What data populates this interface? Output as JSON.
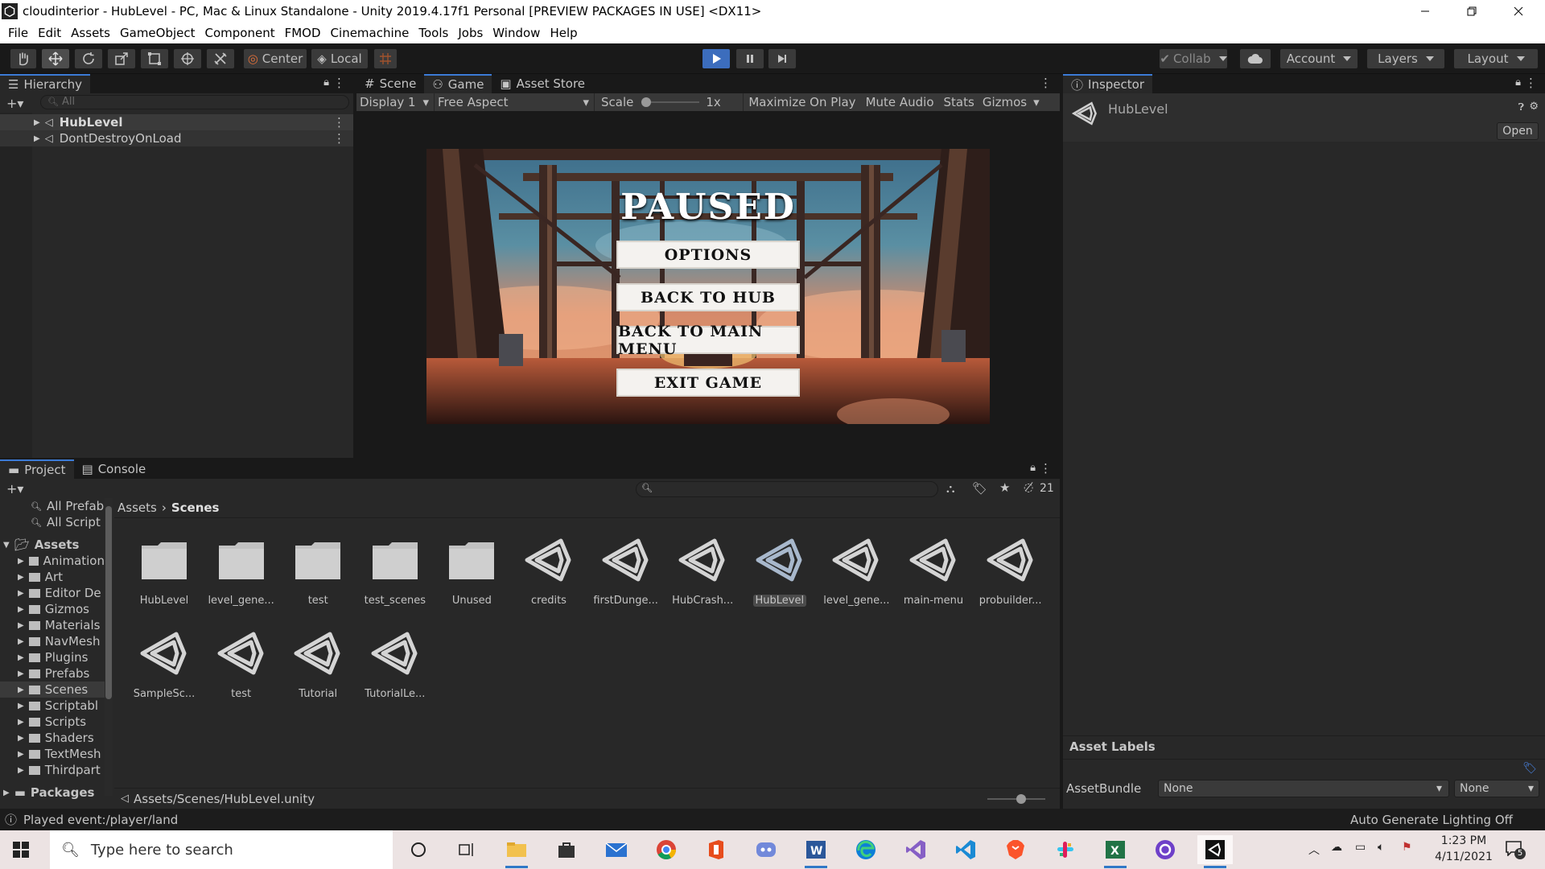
{
  "window": {
    "title": "cloudinterior - HubLevel - PC, Mac & Linux Standalone - Unity 2019.4.17f1 Personal [PREVIEW PACKAGES IN USE] <DX11>"
  },
  "menu": [
    "File",
    "Edit",
    "Assets",
    "GameObject",
    "Component",
    "FMOD",
    "Cinemachine",
    "Tools",
    "Jobs",
    "Window",
    "Help"
  ],
  "toolbar": {
    "pivot": "Center",
    "space": "Local",
    "collab": "Collab",
    "account": "Account",
    "layers": "Layers",
    "layout": "Layout"
  },
  "hierarchy": {
    "tab": "Hierarchy",
    "search_placeholder": "All",
    "items": [
      "HubLevel",
      "DontDestroyOnLoad"
    ]
  },
  "viewtabs": {
    "scene": "Scene",
    "game": "Game",
    "store": "Asset Store"
  },
  "gamebar": {
    "display": "Display 1",
    "aspect": "Free Aspect",
    "scale_label": "Scale",
    "scale_value": "1x",
    "maximize": "Maximize On Play",
    "mute": "Mute Audio",
    "stats": "Stats",
    "gizmos": "Gizmos"
  },
  "pause_menu": {
    "title": "PAUSED",
    "buttons": [
      "OPTIONS",
      "BACK TO HUB",
      "BACK TO MAIN MENU",
      "EXIT GAME"
    ]
  },
  "inspector": {
    "tab": "Inspector",
    "object": "HubLevel",
    "open": "Open",
    "labels_header": "Asset Labels",
    "bundle_label": "AssetBundle",
    "bundle_value": "None",
    "variant_value": "None"
  },
  "project": {
    "tabs": [
      "Project",
      "Console"
    ],
    "hidden_count": "21",
    "favorites": [
      "All Prefab",
      "All Script"
    ],
    "tree_root": "Assets",
    "tree": [
      "Animation",
      "Art",
      "Editor De",
      "Gizmos",
      "Materials",
      "NavMesh",
      "Plugins",
      "Prefabs",
      "Scenes",
      "Scriptabl",
      "Scripts",
      "Shaders",
      "TextMesh",
      "Thirdpart"
    ],
    "packages": "Packages",
    "breadcrumb": [
      "Assets",
      "Scenes"
    ],
    "assets": [
      {
        "name": "HubLevel",
        "type": "folder"
      },
      {
        "name": "level_gene...",
        "type": "folder"
      },
      {
        "name": "test",
        "type": "folder"
      },
      {
        "name": "test_scenes",
        "type": "folder"
      },
      {
        "name": "Unused",
        "type": "folder"
      },
      {
        "name": "credits",
        "type": "scene"
      },
      {
        "name": "firstDunge...",
        "type": "scene"
      },
      {
        "name": "HubCrash...",
        "type": "scene"
      },
      {
        "name": "HubLevel",
        "type": "scene",
        "selected": true
      },
      {
        "name": "level_gene...",
        "type": "scene"
      },
      {
        "name": "main-menu",
        "type": "scene"
      },
      {
        "name": "probuilder...",
        "type": "scene"
      },
      {
        "name": "SampleSc...",
        "type": "scene"
      },
      {
        "name": "test",
        "type": "scene"
      },
      {
        "name": "Tutorial",
        "type": "scene"
      },
      {
        "name": "TutorialLe...",
        "type": "scene"
      }
    ],
    "path": "Assets/Scenes/HubLevel.unity"
  },
  "status": {
    "message": "Played event:/player/land",
    "lighting": "Auto Generate Lighting Off"
  },
  "taskbar": {
    "search": "Type here to search",
    "time": "1:23 PM",
    "date": "4/11/2021",
    "notifications": "5"
  },
  "colors": {
    "accent": "#3c7bd6",
    "panel": "#282828",
    "background": "#191919"
  }
}
